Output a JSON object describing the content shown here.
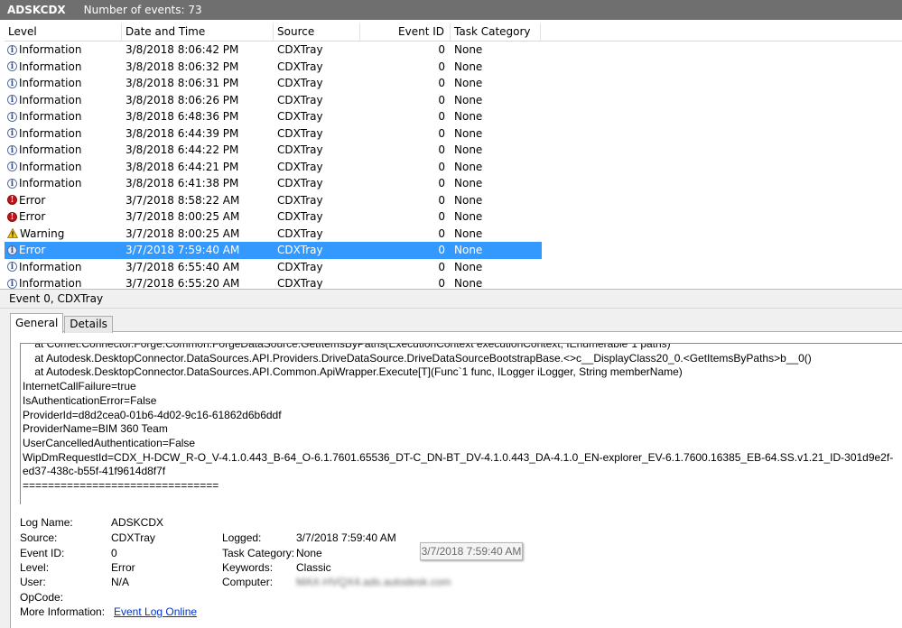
{
  "titlebar": {
    "log_name": "ADSKCDX",
    "count_text": "Number of events: 73"
  },
  "columns": [
    "Level",
    "Date and Time",
    "Source",
    "Event ID",
    "Task Category"
  ],
  "events": [
    {
      "level": "Information",
      "icon": "info-icon",
      "date": "3/8/2018 8:06:42 PM",
      "source": "CDXTray",
      "id": "0",
      "category": "None"
    },
    {
      "level": "Information",
      "icon": "info-icon",
      "date": "3/8/2018 8:06:32 PM",
      "source": "CDXTray",
      "id": "0",
      "category": "None"
    },
    {
      "level": "Information",
      "icon": "info-icon",
      "date": "3/8/2018 8:06:31 PM",
      "source": "CDXTray",
      "id": "0",
      "category": "None"
    },
    {
      "level": "Information",
      "icon": "info-icon",
      "date": "3/8/2018 8:06:26 PM",
      "source": "CDXTray",
      "id": "0",
      "category": "None"
    },
    {
      "level": "Information",
      "icon": "info-icon",
      "date": "3/8/2018 6:48:36 PM",
      "source": "CDXTray",
      "id": "0",
      "category": "None"
    },
    {
      "level": "Information",
      "icon": "info-icon",
      "date": "3/8/2018 6:44:39 PM",
      "source": "CDXTray",
      "id": "0",
      "category": "None"
    },
    {
      "level": "Information",
      "icon": "info-icon",
      "date": "3/8/2018 6:44:22 PM",
      "source": "CDXTray",
      "id": "0",
      "category": "None"
    },
    {
      "level": "Information",
      "icon": "info-icon",
      "date": "3/8/2018 6:44:21 PM",
      "source": "CDXTray",
      "id": "0",
      "category": "None"
    },
    {
      "level": "Information",
      "icon": "info-icon",
      "date": "3/8/2018 6:41:38 PM",
      "source": "CDXTray",
      "id": "0",
      "category": "None"
    },
    {
      "level": "Error",
      "icon": "error-icon",
      "date": "3/7/2018 8:58:22 AM",
      "source": "CDXTray",
      "id": "0",
      "category": "None"
    },
    {
      "level": "Error",
      "icon": "error-icon",
      "date": "3/7/2018 8:00:25 AM",
      "source": "CDXTray",
      "id": "0",
      "category": "None"
    },
    {
      "level": "Warning",
      "icon": "warning-icon",
      "date": "3/7/2018 8:00:25 AM",
      "source": "CDXTray",
      "id": "0",
      "category": "None"
    },
    {
      "level": "Error",
      "icon": "info-icon",
      "date": "3/7/2018 7:59:40 AM",
      "source": "CDXTray",
      "id": "0",
      "category": "None",
      "selected": true
    },
    {
      "level": "Information",
      "icon": "info-icon",
      "date": "3/7/2018 6:55:40 AM",
      "source": "CDXTray",
      "id": "0",
      "category": "None"
    },
    {
      "level": "Information",
      "icon": "info-icon",
      "date": "3/7/2018 6:55:20 AM",
      "source": "CDXTray",
      "id": "0",
      "category": "None"
    }
  ],
  "detail": {
    "header": "Event 0, CDXTray",
    "tabs": [
      "General",
      "Details"
    ],
    "message_lines": [
      "    at Comet.Connector.Forge.Common.ForgeDataSource.GetItemsByPaths(ExecutionContext executionContext, IEnumerable`1 paths)",
      "    at Autodesk.DesktopConnector.DataSources.API.Providers.DriveDataSource.DriveDataSourceBootstrapBase.<>c__DisplayClass20_0.<GetItemsByPaths>b__0()",
      "    at Autodesk.DesktopConnector.DataSources.API.Common.ApiWrapper.Execute[T](Func`1 func, ILogger iLogger, String memberName)",
      "InternetCallFailure=true",
      "IsAuthenticationError=False",
      "ProviderId=d8d2cea0-01b6-4d02-9c16-61862d6b6ddf",
      "ProviderName=BIM 360 Team",
      "UserCancelledAuthentication=False",
      "WipDmRequestId=CDX_H-DCW_R-O_V-4.1.0.443_B-64_O-6.1.7601.65536_DT-C_DN-BT_DV-4.1.0.443_DA-4.1.0_EN-explorer_EV-6.1.7600.16385_EB-64.SS.v1.21_ID-301d9e2f-ed37-438c-b55f-41f9614d8f7f",
      "==============================="
    ],
    "props": {
      "log_name_label": "Log Name:",
      "log_name": "ADSKCDX",
      "source_label": "Source:",
      "source": "CDXTray",
      "logged_label": "Logged:",
      "logged": "3/7/2018 7:59:40 AM",
      "event_id_label": "Event ID:",
      "event_id": "0",
      "task_category_label": "Task Category:",
      "task_category": "None",
      "level_label": "Level:",
      "level": "Error",
      "keywords_label": "Keywords:",
      "keywords": "Classic",
      "user_label": "User:",
      "user": "N/A",
      "computer_label": "Computer:",
      "computer": "MAX-HVQX4.ads.autodesk.com",
      "opcode_label": "OpCode:",
      "more_info_label": "More Information:",
      "more_info_link": "Event Log Online"
    },
    "tooltip": "3/7/2018 7:59:40 AM"
  }
}
